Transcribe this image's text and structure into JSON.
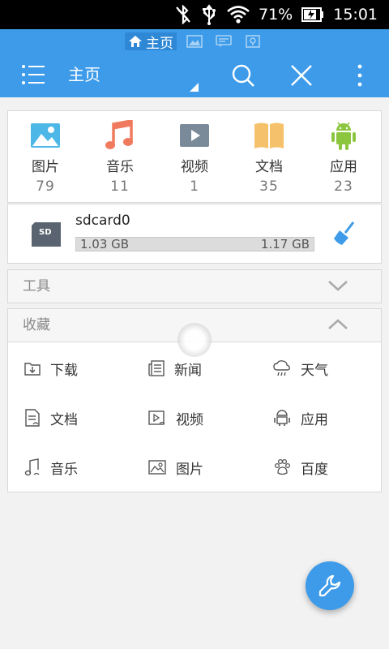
{
  "status": {
    "battery_percent": "71%",
    "time": "15:01"
  },
  "window_tabs": [
    {
      "label": "主页",
      "active": true
    },
    {
      "label": "",
      "active": false
    },
    {
      "label": "",
      "active": false
    },
    {
      "label": "",
      "active": false
    }
  ],
  "header": {
    "title": "主页"
  },
  "categories": [
    {
      "label": "图片",
      "count": "79",
      "icon": "image-icon",
      "color": "#4db8e8"
    },
    {
      "label": "音乐",
      "count": "11",
      "icon": "music-note-icon",
      "color": "#f07a5e"
    },
    {
      "label": "视频",
      "count": "1",
      "icon": "video-play-icon",
      "color": "#7a8a99"
    },
    {
      "label": "文档",
      "count": "35",
      "icon": "book-icon",
      "color": "#f5c26b"
    },
    {
      "label": "应用",
      "count": "23",
      "icon": "android-icon",
      "color": "#8cc63f"
    }
  ],
  "storage": {
    "name": "sdcard0",
    "used": "1.03 GB",
    "total": "1.17 GB",
    "used_fraction": 0.88
  },
  "sections": {
    "tools": "工具",
    "favorites": "收藏"
  },
  "favorites": [
    {
      "label": "下载",
      "icon": "download-icon"
    },
    {
      "label": "新闻",
      "icon": "news-icon"
    },
    {
      "label": "天气",
      "icon": "weather-cloud-icon"
    },
    {
      "label": "文档",
      "icon": "document-icon"
    },
    {
      "label": "视频",
      "icon": "video-icon"
    },
    {
      "label": "应用",
      "icon": "app-icon"
    },
    {
      "label": "音乐",
      "icon": "music-icon"
    },
    {
      "label": "图片",
      "icon": "picture-icon"
    },
    {
      "label": "百度",
      "icon": "paw-icon"
    }
  ],
  "colors": {
    "accent": "#3d9be9",
    "status_bar": "#000000"
  }
}
